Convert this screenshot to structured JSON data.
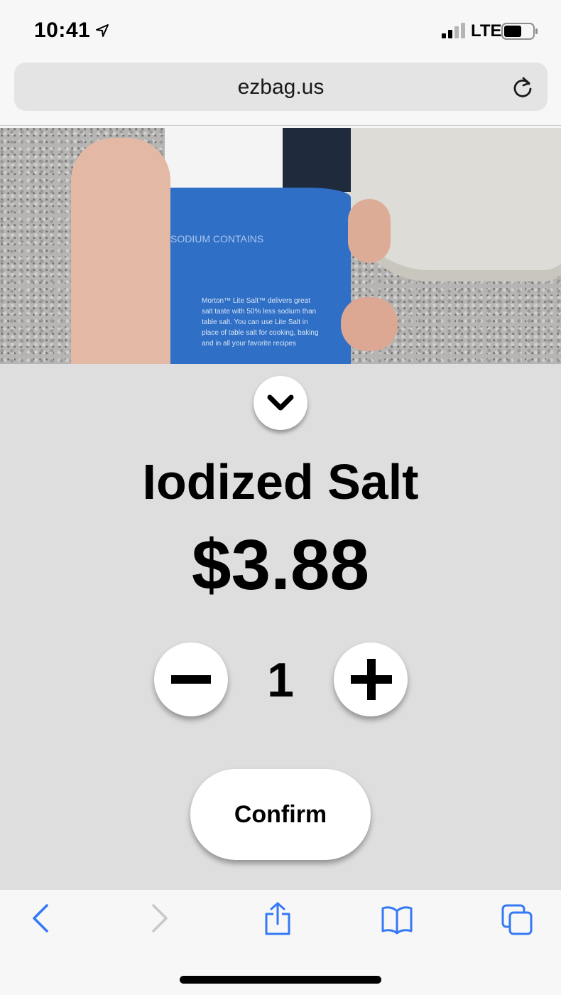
{
  "status_bar": {
    "time": "10:41",
    "carrier": "LTE",
    "icons": [
      "location-arrow-icon",
      "signal-icon",
      "battery-icon"
    ]
  },
  "browser": {
    "url": "ezbag.us",
    "reload_icon": "reload-icon"
  },
  "product": {
    "name": "Iodized Salt",
    "price": "$3.88",
    "quantity": "1",
    "camera_label_text": "Morton™ Lite Salt™ delivers great salt taste with 50% less sodium than table salt. You can use Lite Salt in place of table salt for cooking, baking and in all your favorite recipes",
    "camera_sodium_text": "SODIUM CONTAINS"
  },
  "controls": {
    "collapse_icon": "chevron-down-icon",
    "decrement_icon": "minus-icon",
    "increment_icon": "plus-icon",
    "confirm_label": "Confirm"
  },
  "toolbar": {
    "items": [
      "back-icon",
      "forward-icon",
      "share-icon",
      "bookmarks-icon",
      "tabs-icon"
    ],
    "accent_color": "#3478f6",
    "disabled_color": "#c7c7cc"
  }
}
